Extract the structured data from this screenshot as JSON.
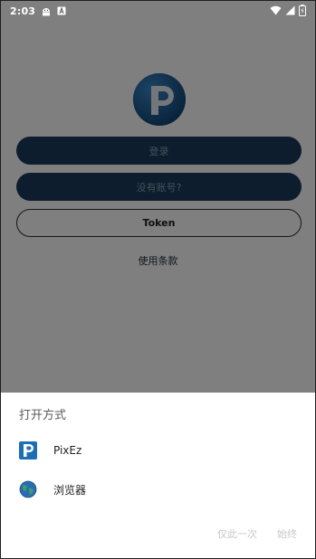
{
  "status_bar": {
    "time": "2:03"
  },
  "login": {
    "login_label": "登录",
    "register_label": "没有账号?",
    "token_label": "Token",
    "terms_label": "使用条款"
  },
  "open_with": {
    "title": "打开方式",
    "options": [
      {
        "label": "PixEz",
        "icon": "pixez-app-icon"
      },
      {
        "label": "浏览器",
        "icon": "browser-globe-icon"
      }
    ],
    "just_once_label": "仅此一次",
    "always_label": "始终"
  },
  "colors": {
    "button_bg": "#1a3a5a",
    "scrim": "rgba(0,0,0,0.5)"
  }
}
